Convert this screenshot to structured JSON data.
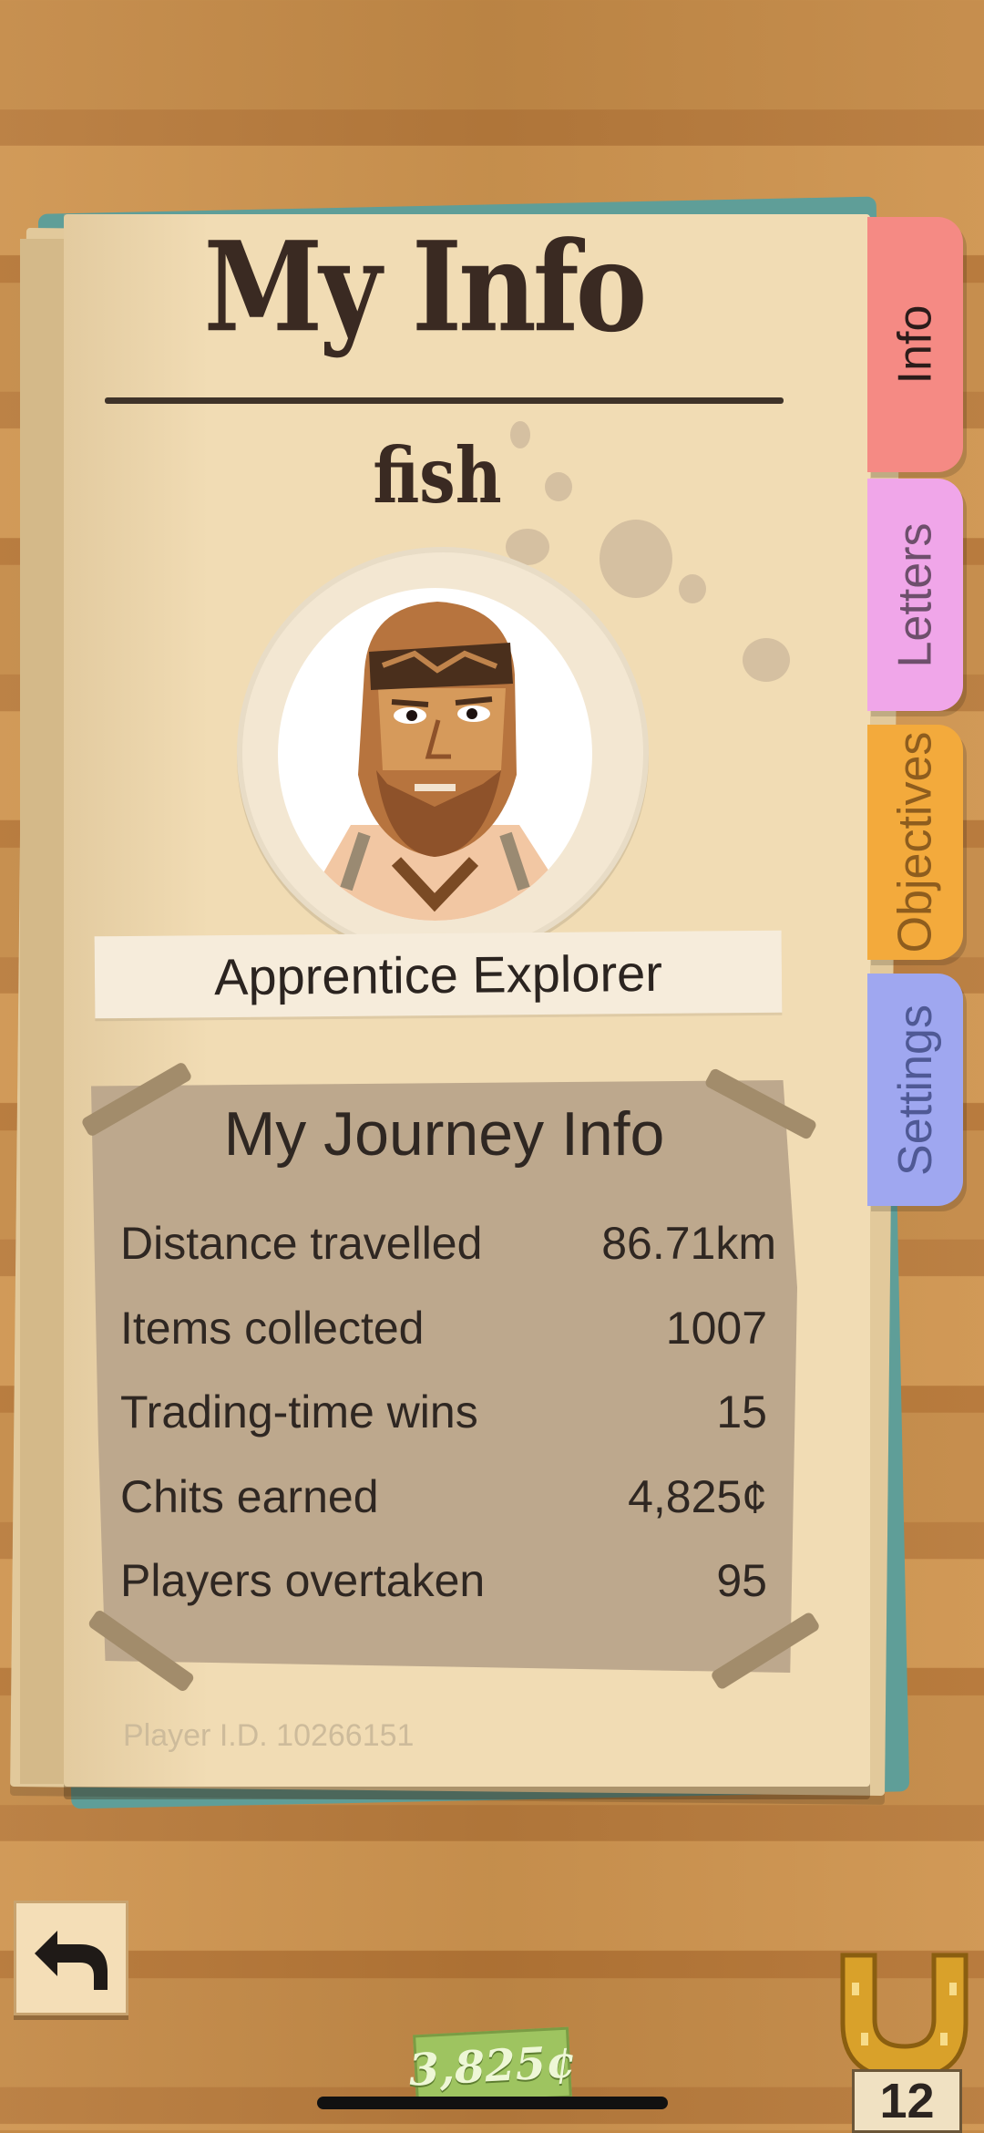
{
  "page": {
    "title": "My Info",
    "username": "fish",
    "rank": "Apprentice Explorer"
  },
  "tabs": [
    {
      "label": "Info",
      "active": true
    },
    {
      "label": "Letters",
      "active": false
    },
    {
      "label": "Objectives",
      "active": false
    },
    {
      "label": "Settings",
      "active": false
    }
  ],
  "journey": {
    "title": "My Journey Info",
    "stats": [
      {
        "label": "Distance travelled",
        "value": "86.71km"
      },
      {
        "label": "Items collected",
        "value": "1007"
      },
      {
        "label": "Trading-time wins",
        "value": "15"
      },
      {
        "label": "Chits earned",
        "value": "4,825¢"
      },
      {
        "label": "Players overtaken",
        "value": "95"
      }
    ]
  },
  "player_id": "Player I.D. 10266151",
  "bottom_bar": {
    "currency": "3,825¢",
    "horseshoes": "12"
  },
  "icons": {
    "back": "back-arrow-icon",
    "avatar": "bearded-explorer-avatar",
    "horseshoe": "horseshoe-icon"
  }
}
